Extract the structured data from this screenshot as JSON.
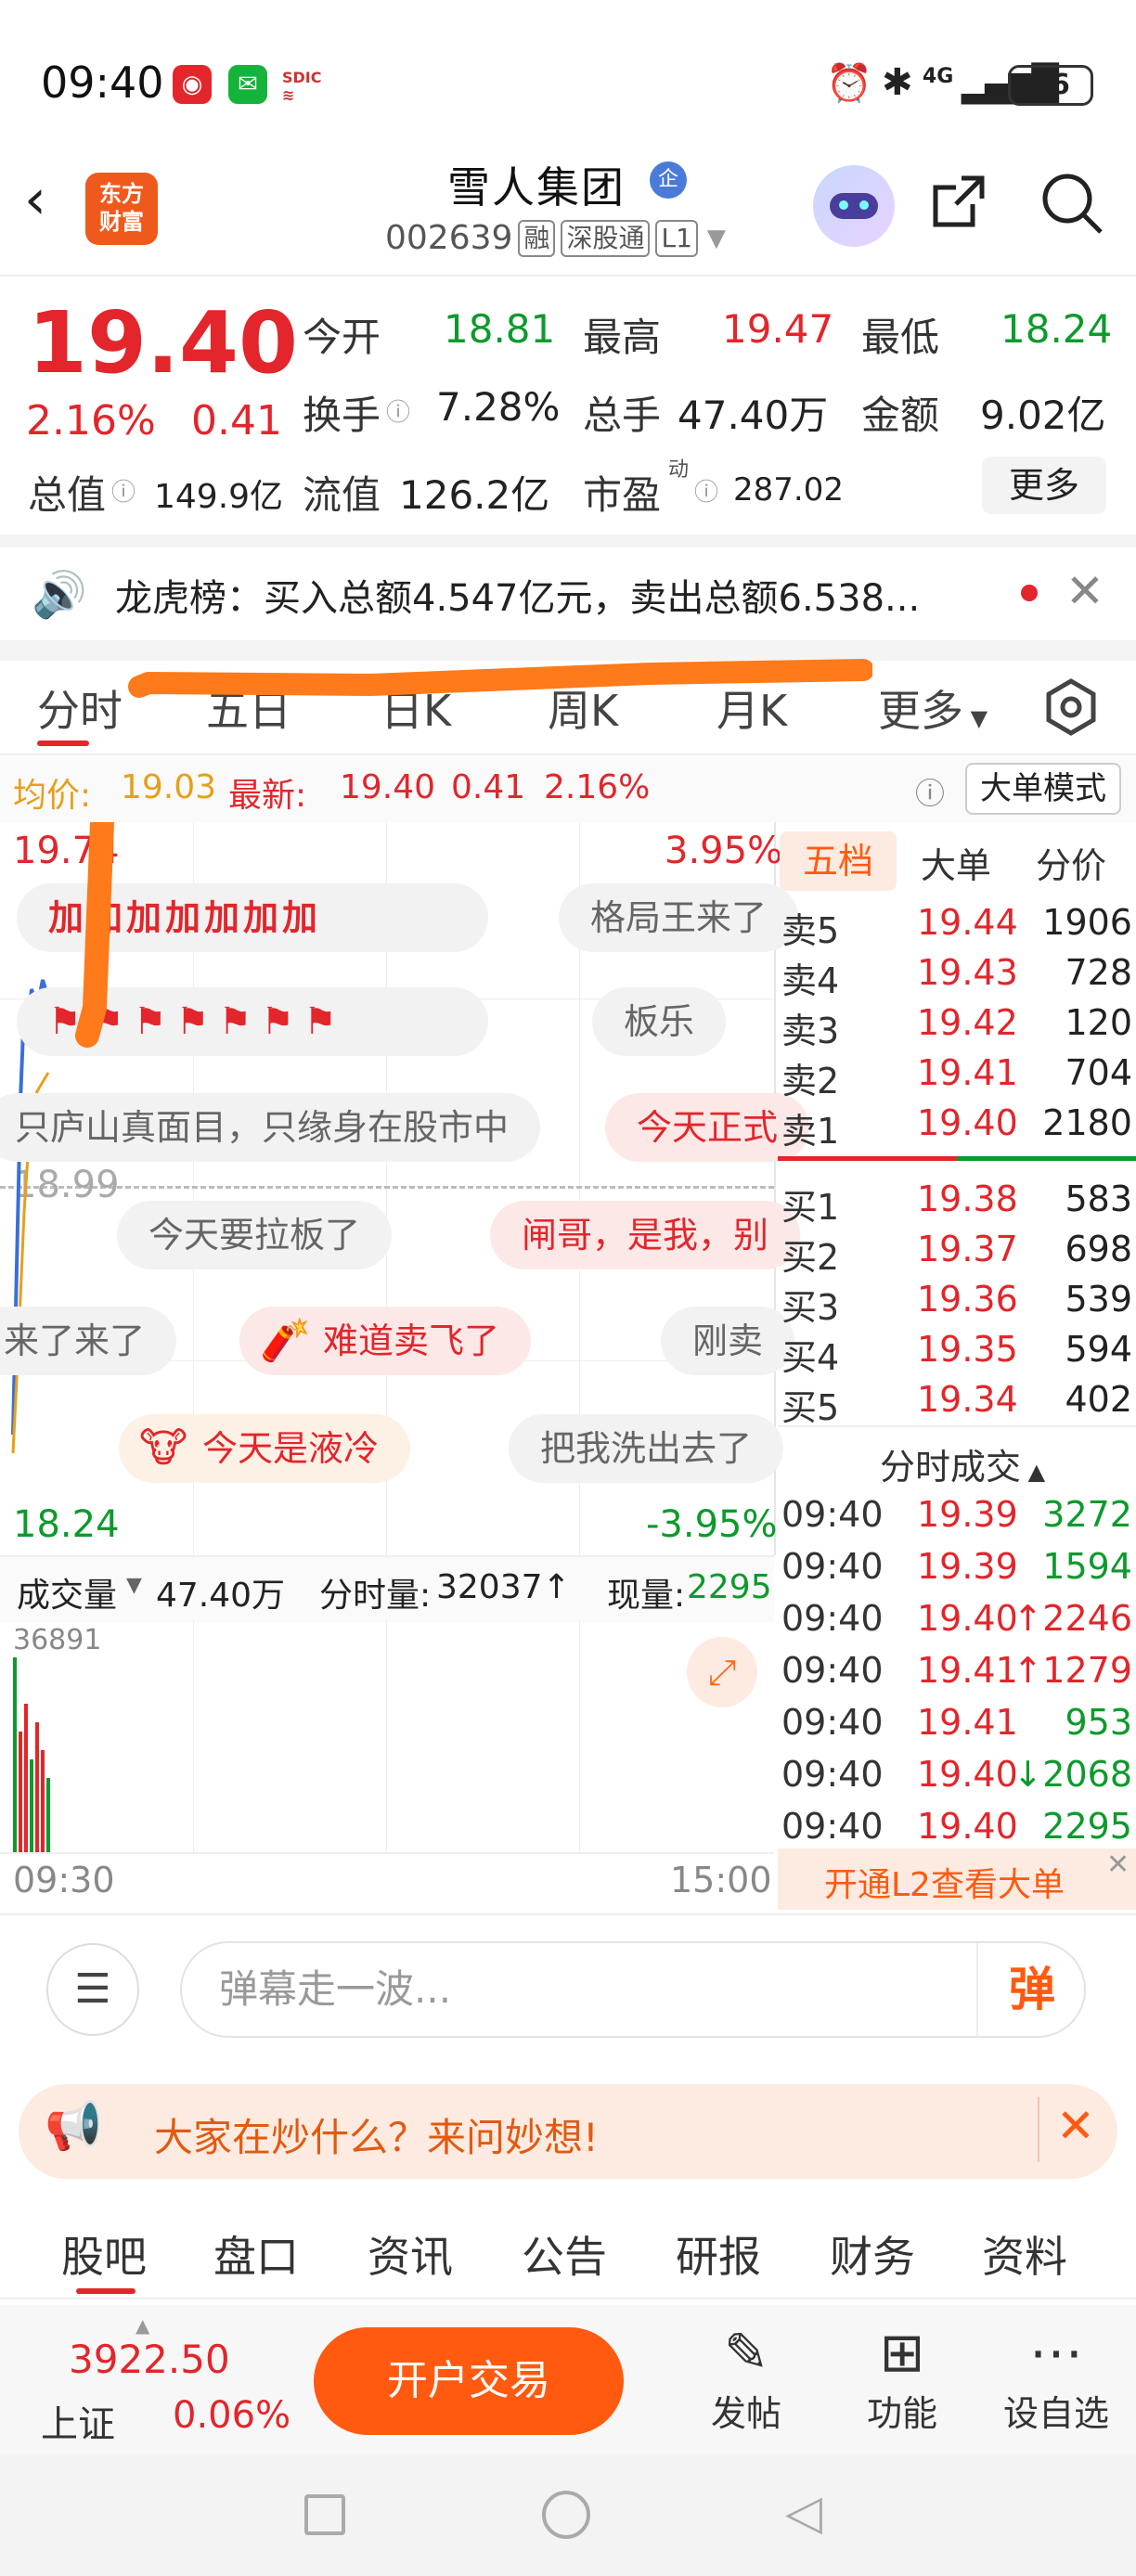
{
  "status": {
    "time": "09:40",
    "network": "4G",
    "battery": "86"
  },
  "header": {
    "stock_name": "雪人集团",
    "badge": "企",
    "code": "002639",
    "tags": [
      "融",
      "深股通",
      "L1"
    ],
    "logo": "东方\n财富"
  },
  "quote": {
    "price": "19.40",
    "change_pct": "2.16%",
    "change_abs": "0.41",
    "open_label": "今开",
    "open": "18.81",
    "high_label": "最高",
    "high": "19.47",
    "low_label": "最低",
    "low": "18.24",
    "turnover_label": "换手",
    "turnover": "7.28%",
    "volume_label": "总手",
    "volume": "47.40万",
    "amount_label": "金额",
    "amount": "9.02亿",
    "mcap_label": "总值",
    "mcap": "149.9亿",
    "float_label": "流值",
    "float": "126.2亿",
    "pe_label": "市盈",
    "pe_sup": "动",
    "pe": "287.02",
    "more": "更多"
  },
  "notice": {
    "text": "龙虎榜：买入总额4.547亿元，卖出总额6.538..."
  },
  "tabs": {
    "items": [
      "分时",
      "五日",
      "日K",
      "周K",
      "月K"
    ],
    "more": "更多"
  },
  "avg_bar": {
    "avg_label": "均价:",
    "avg": "19.03",
    "latest_label": "最新:",
    "latest": "19.40",
    "chg": "0.41",
    "pct": "2.16%",
    "mode": "大单模式"
  },
  "chart": {
    "top_price": "19.74",
    "top_pct": "3.95%",
    "mid_price": "18.99",
    "bottom_price": "18.24",
    "bottom_pct": "-3.95%",
    "danmu": [
      "加加加加加加加",
      "格局王来了",
      "板乐",
      "只庐山真面目，只缘身在股市中",
      "今天正式",
      "今天要拉板了",
      "闸哥，是我，别",
      "来了来了",
      "难道卖飞了",
      "刚卖",
      "今天是液冷",
      "把我洗出去了"
    ]
  },
  "volume_bar": {
    "label": "成交量",
    "total": "47.40万",
    "tick_label": "分时量:",
    "tick": "32037↑",
    "now_label": "现量:",
    "now": "2295",
    "max": "36891",
    "start_time": "09:30",
    "end_time": "15:00"
  },
  "orderbook": {
    "tabs": [
      "五档",
      "大单",
      "分价"
    ],
    "asks": [
      {
        "label": "卖5",
        "price": "19.44",
        "vol": "1906"
      },
      {
        "label": "卖4",
        "price": "19.43",
        "vol": "728"
      },
      {
        "label": "卖3",
        "price": "19.42",
        "vol": "120"
      },
      {
        "label": "卖2",
        "price": "19.41",
        "vol": "704"
      },
      {
        "label": "卖1",
        "price": "19.40",
        "vol": "2180"
      }
    ],
    "bids": [
      {
        "label": "买1",
        "price": "19.38",
        "vol": "583"
      },
      {
        "label": "买2",
        "price": "19.37",
        "vol": "698"
      },
      {
        "label": "买3",
        "price": "19.36",
        "vol": "539"
      },
      {
        "label": "买4",
        "price": "19.35",
        "vol": "594"
      },
      {
        "label": "买5",
        "price": "19.34",
        "vol": "402"
      }
    ],
    "ticks_title": "分时成交",
    "ticks": [
      {
        "time": "09:40",
        "price": "19.39",
        "vol": "3272"
      },
      {
        "time": "09:40",
        "price": "19.39",
        "vol": "1594"
      },
      {
        "time": "09:40",
        "price": "19.40",
        "vol": "↑2246"
      },
      {
        "time": "09:40",
        "price": "19.41",
        "vol": "↑1279"
      },
      {
        "time": "09:40",
        "price": "19.41",
        "vol": "953"
      },
      {
        "time": "09:40",
        "price": "19.40",
        "vol": "↓2068"
      },
      {
        "time": "09:40",
        "price": "19.40",
        "vol": "2295"
      }
    ],
    "l2_text": "开通L2查看大单"
  },
  "input": {
    "placeholder": "弹幕走一波...",
    "send": "弹"
  },
  "ask_banner": {
    "text": "大家在炒什么？来问妙想!"
  },
  "bottom_tabs": [
    "股吧",
    "盘口",
    "资讯",
    "公告",
    "研报",
    "财务",
    "资料"
  ],
  "bottom_bar": {
    "index_value": "3922.50",
    "index_name": "上证",
    "index_pct": "0.06%",
    "open_trade": "开户交易",
    "post": "发帖",
    "func": "功能",
    "watch": "设自选"
  }
}
